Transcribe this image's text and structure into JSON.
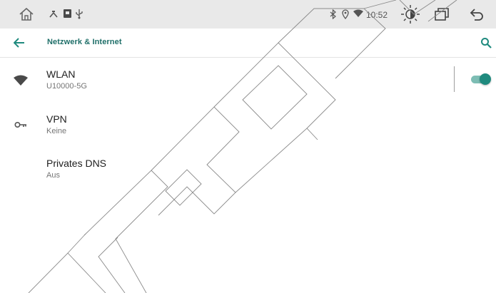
{
  "statusbar": {
    "time": "10:52",
    "icons": [
      "home-icon",
      "dims-icon",
      "sd-card-icon",
      "usb-icon",
      "bluetooth-icon",
      "location-icon",
      "wifi-signal-icon",
      "brightness-icon",
      "recents-icon",
      "back-icon"
    ]
  },
  "toolbar": {
    "title": "Netzwerk & Internet",
    "back_icon": "arrow-left-icon",
    "search_icon": "search-icon"
  },
  "settings": [
    {
      "title": "WLAN",
      "subtitle": "U10000-5G",
      "icon": "wifi-icon",
      "toggle_on": true
    },
    {
      "title": "VPN",
      "subtitle": "Keine",
      "icon": "key-icon"
    },
    {
      "title": "Privates DNS",
      "subtitle": "Aus"
    }
  ],
  "colors": {
    "accent": "#1f8a7e",
    "title": "#1f6f69",
    "statusbar_bg": "#e9e9e9"
  }
}
